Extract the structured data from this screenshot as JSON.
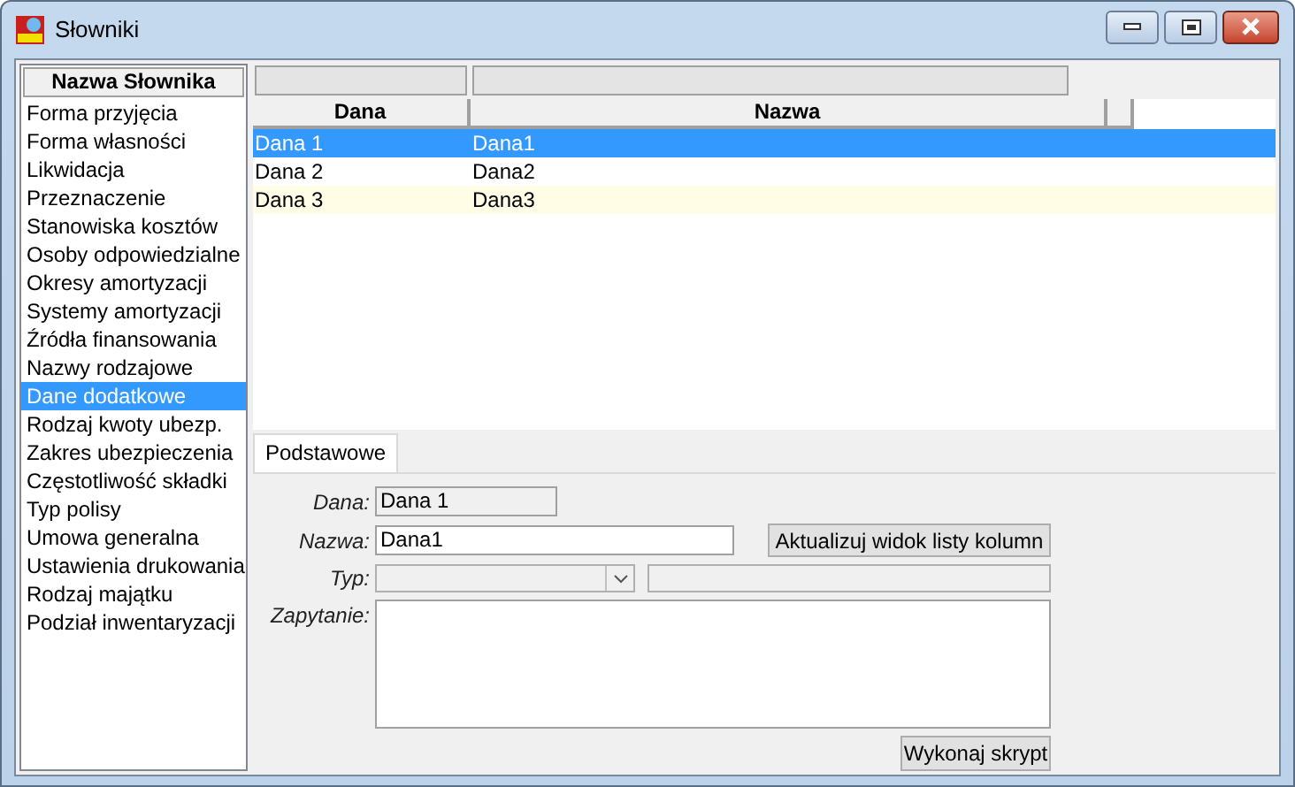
{
  "window": {
    "title": "Słowniki"
  },
  "dictionary_list": {
    "header": "Nazwa Słownika",
    "items": [
      {
        "label": "Forma przyjęcia",
        "selected": false
      },
      {
        "label": "Forma własności",
        "selected": false
      },
      {
        "label": "Likwidacja",
        "selected": false
      },
      {
        "label": "Przeznaczenie",
        "selected": false
      },
      {
        "label": "Stanowiska kosztów",
        "selected": false
      },
      {
        "label": "Osoby odpowiedzialne",
        "selected": false
      },
      {
        "label": "Okresy amortyzacji",
        "selected": false
      },
      {
        "label": "Systemy amortyzacji",
        "selected": false
      },
      {
        "label": "Źródła finansowania",
        "selected": false
      },
      {
        "label": "Nazwy rodzajowe",
        "selected": false
      },
      {
        "label": "Dane dodatkowe",
        "selected": true
      },
      {
        "label": "Rodzaj kwoty ubezp.",
        "selected": false
      },
      {
        "label": "Zakres ubezpieczenia",
        "selected": false
      },
      {
        "label": "Częstotliwość składki",
        "selected": false
      },
      {
        "label": "Typ polisy",
        "selected": false
      },
      {
        "label": "Umowa generalna",
        "selected": false
      },
      {
        "label": "Ustawienia drukowania",
        "selected": false
      },
      {
        "label": "Rodzaj majątku",
        "selected": false
      },
      {
        "label": "Podział inwentaryzacji",
        "selected": false
      }
    ]
  },
  "table": {
    "columns": [
      "Dana",
      "Nazwa"
    ],
    "rows": [
      {
        "cells": [
          "Dana 1",
          "Dana1"
        ],
        "selected": true
      },
      {
        "cells": [
          "Dana 2",
          "Dana2"
        ],
        "selected": false
      },
      {
        "cells": [
          "Dana 3",
          "Dana3"
        ],
        "selected": false
      }
    ]
  },
  "tabs": [
    {
      "label": "Podstawowe",
      "selected": true
    }
  ],
  "form": {
    "dana_label": "Dana:",
    "dana_value": "Dana 1",
    "nazwa_label": "Nazwa:",
    "nazwa_value": "Dana1",
    "update_button": "Aktualizuj widok listy kolumn",
    "typ_label": "Typ:",
    "query_label": "Zapytanie:",
    "run_button": "Wykonaj skrypt"
  }
}
